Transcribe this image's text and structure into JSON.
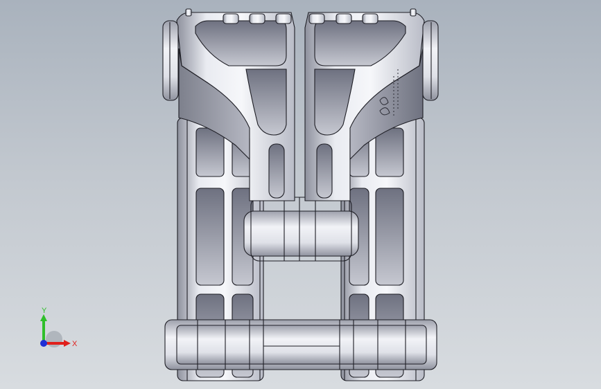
{
  "viewport": {
    "background_top": "#a9b2bd",
    "background_bottom": "#d8dce0"
  },
  "model": {
    "description_icon": "cad-part-icon",
    "metal_light": "#f2f3f7",
    "metal_mid": "#c9cbd4",
    "metal_dark": "#7f8290",
    "edge_color": "#1d1d24",
    "shadow_face": "#a9abb7"
  },
  "triad": {
    "x_label": "X",
    "y_label": "Y",
    "x_color": "#e0201c",
    "y_color": "#2fbf2a",
    "z_color": "#1f2fd6"
  }
}
